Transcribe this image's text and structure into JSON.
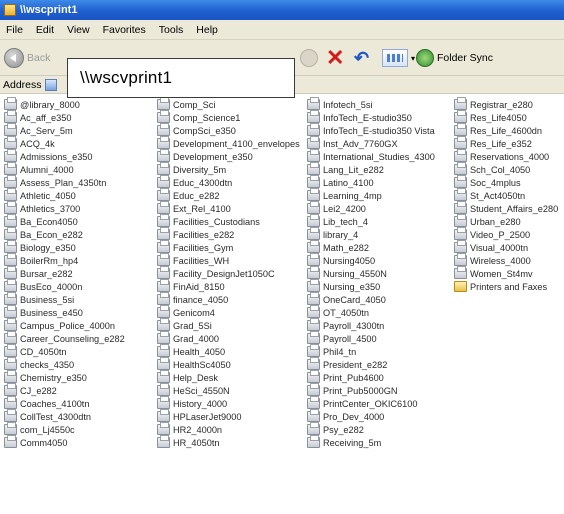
{
  "window": {
    "title": "\\\\wscprint1"
  },
  "menu": [
    "File",
    "Edit",
    "View",
    "Favorites",
    "Tools",
    "Help"
  ],
  "toolbar": {
    "back_label": "Back",
    "folder_sync_label": "Folder Sync"
  },
  "address": {
    "label": "Address"
  },
  "callout": {
    "text": "\\\\wscvprint1"
  },
  "columns": [
    [
      "@library_8000",
      "Ac_aff_e350",
      "Ac_Serv_5m",
      "ACQ_4k",
      "Admissions_e350",
      "Alumni_4000",
      "Assess_Plan_4350tn",
      "Athletic_4050",
      "Athletics_3700",
      "Ba_Econ4050",
      "Ba_Econ_e282",
      "Biology_e350",
      "BoilerRm_hp4",
      "Bursar_e282",
      "BusEco_4000n",
      "Business_5si",
      "Business_e450",
      "Campus_Police_4000n",
      "Career_Counseling_e282",
      "CD_4050tn",
      "checks_4350",
      "Chemistry_e350",
      "CJ_e282",
      "Coaches_4100tn",
      "CollTest_4300dtn",
      "com_Lj4550c",
      "Comm4050"
    ],
    [
      "Comp_Sci",
      "Comp_Science1",
      "CompSci_e350",
      "Development_4100_envelopes",
      "Development_e350",
      "Diversity_5m",
      "Educ_4300dtn",
      "Educ_e282",
      "Ext_Rel_4100",
      "Facilities_Custodians",
      "Facilities_e282",
      "Facilities_Gym",
      "Facilities_WH",
      "Facility_DesignJet1050C",
      "FinAid_8150",
      "finance_4050",
      "Genicom4",
      "Grad_5Si",
      "Grad_4000",
      "Health_4050",
      "HealthSc4050",
      "Help_Desk",
      "HeSci_4550N",
      "History_4000",
      "HPLaserJet9000",
      "HR2_4000n",
      "HR_4050tn"
    ],
    [
      "Infotech_5si",
      "InfoTech_E-studio350",
      "InfoTech_E-studio350 Vista",
      "Inst_Adv_7760GX",
      "International_Studies_4300",
      "Lang_Lit_e282",
      "Latino_4100",
      "Learning_4mp",
      "Lei2_4200",
      "Lib_tech_4",
      "library_4",
      "Math_e282",
      "Nursing4050",
      "Nursing_4550N",
      "Nursing_e350",
      "OneCard_4050",
      "OT_4050tn",
      "Payroll_4300tn",
      "Payroll_4500",
      "Phil4_tn",
      "President_e282",
      "Print_Pub4600",
      "Print_Pub5000GN",
      "PrintCenter_OKIC6100",
      "Pro_Dev_4000",
      "Psy_e282",
      "Receiving_5m"
    ],
    [
      "Registrar_e280",
      "Res_Life4050",
      "Res_Life_4600dn",
      "Res_Life_e352",
      "Reservations_4000",
      "Sch_Col_4050",
      "Soc_4mplus",
      "St_Act4050tn",
      "Student_Affairs_e280",
      "Urban_e280",
      "Video_P_2500",
      "Visual_4000tn",
      "Wireless_4000",
      "Women_St4mv",
      "Printers and Faxes"
    ]
  ]
}
